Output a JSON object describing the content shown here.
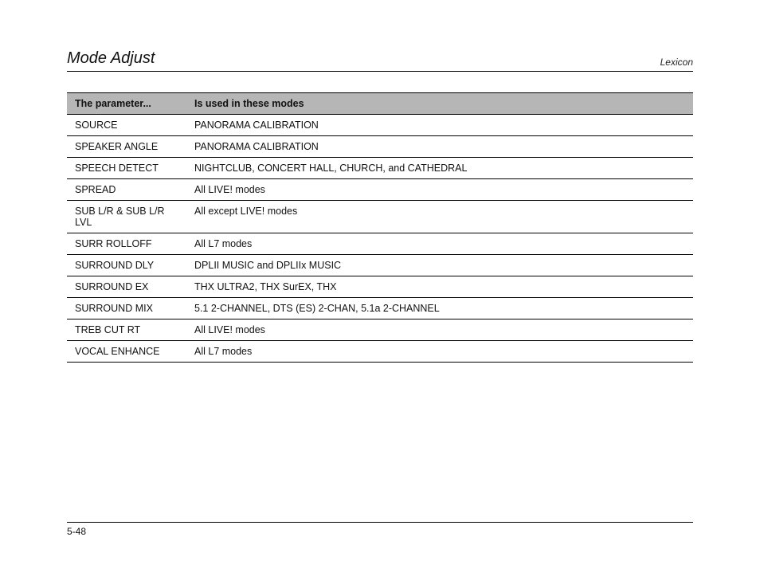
{
  "header": {
    "title": "Mode Adjust",
    "brand": "Lexicon"
  },
  "table": {
    "headers": {
      "param": "The parameter...",
      "modes": "Is used in these modes"
    },
    "rows": [
      {
        "param": "SOURCE",
        "modes": "PANORAMA CALIBRATION"
      },
      {
        "param": "SPEAKER ANGLE",
        "modes": "PANORAMA CALIBRATION"
      },
      {
        "param": "SPEECH DETECT",
        "modes": "NIGHTCLUB, CONCERT HALL, CHURCH, and CATHEDRAL"
      },
      {
        "param": "SPREAD",
        "modes": "All LIVE! modes"
      },
      {
        "param": "SUB L/R & SUB L/R LVL",
        "modes": "All except LIVE! modes"
      },
      {
        "param": "SURR ROLLOFF",
        "modes": "All L7 modes"
      },
      {
        "param": "SURROUND DLY",
        "modes": "DPLII MUSIC and DPLIIx MUSIC"
      },
      {
        "param": "SURROUND EX",
        "modes": "THX ULTRA2, THX SurEX, THX"
      },
      {
        "param": "SURROUND MIX",
        "modes": "5.1 2-CHANNEL, DTS (ES) 2-CHAN, 5.1a 2-CHANNEL"
      },
      {
        "param": "TREB CUT RT",
        "modes": "All LIVE! modes"
      },
      {
        "param": "VOCAL ENHANCE",
        "modes": "All L7 modes"
      }
    ]
  },
  "footer": {
    "page_number": "5-48"
  }
}
